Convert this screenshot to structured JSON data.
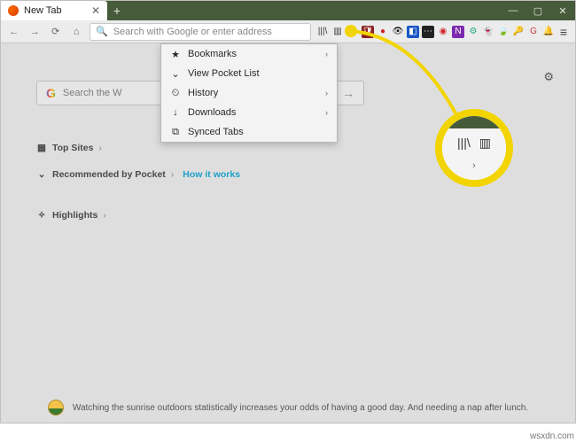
{
  "window": {
    "tab_title": "New Tab",
    "newtab_label": "+",
    "controls": {
      "min": "—",
      "max": "▢",
      "close": "✕"
    }
  },
  "toolbar": {
    "back": "←",
    "forward": "→",
    "reload": "⟳",
    "home": "⌂",
    "address_placeholder": "Search with Google or enter address",
    "menu": "≡"
  },
  "icons": {
    "library": "|||\\",
    "sidebar": "▥",
    "fx": "✦",
    "ublock": "🛡",
    "dark": "●",
    "capture": "👁",
    "container": "◧",
    "square_blue": "■",
    "dots": "⋯",
    "adblock": "◉",
    "onenote": "N",
    "gear": "⚙",
    "ghost": "👻",
    "leaf": "🍃",
    "key": "🔑",
    "gclr": "G",
    "bell": "🔔"
  },
  "menu": {
    "bookmarks": "Bookmarks",
    "pocket": "View Pocket List",
    "history": "History",
    "downloads": "Downloads",
    "synced": "Synced Tabs"
  },
  "search": {
    "placeholder": "Search the W",
    "go": "→"
  },
  "sections": {
    "topsites": "Top Sites",
    "recommended": "Recommended by Pocket",
    "how": "How it works",
    "highlights": "Highlights"
  },
  "snippet": {
    "text": "Watching the sunrise outdoors statistically increases your odds of having a good day. And needing a nap after lunch."
  },
  "watermark": "wsxdn.com"
}
